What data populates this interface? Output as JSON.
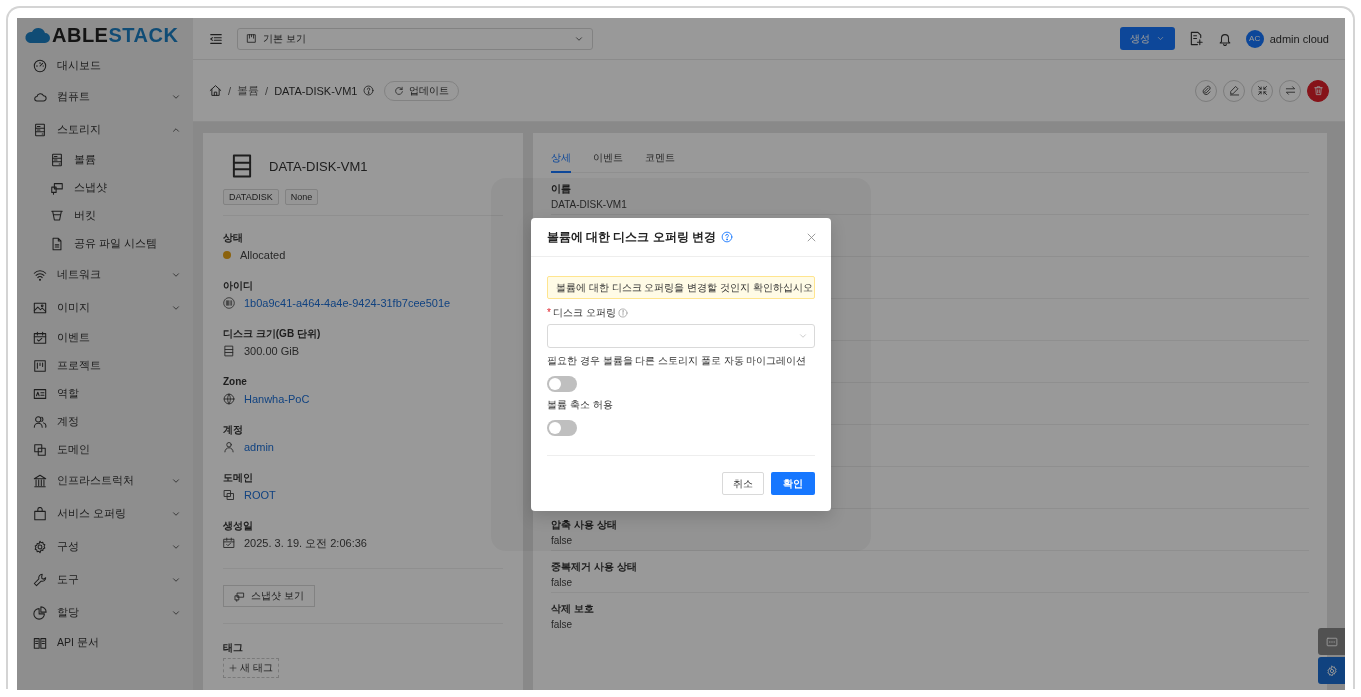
{
  "logo": {
    "first": "ABLE",
    "second": "STACK"
  },
  "sidebar": {
    "items": [
      {
        "label": "대시보드",
        "kind": "link"
      },
      {
        "label": "컴퓨트",
        "kind": "group",
        "expanded": false
      },
      {
        "label": "스토리지",
        "kind": "group",
        "expanded": true,
        "children": [
          {
            "label": "볼륨"
          },
          {
            "label": "스냅샷"
          },
          {
            "label": "버킷"
          },
          {
            "label": "공유 파일 시스템"
          }
        ]
      },
      {
        "label": "네트워크",
        "kind": "group",
        "expanded": false
      },
      {
        "label": "이미지",
        "kind": "group",
        "expanded": false
      },
      {
        "label": "이벤트",
        "kind": "link"
      },
      {
        "label": "프로젝트",
        "kind": "link"
      },
      {
        "label": "역할",
        "kind": "link"
      },
      {
        "label": "계정",
        "kind": "link"
      },
      {
        "label": "도메인",
        "kind": "link"
      },
      {
        "label": "인프라스트럭처",
        "kind": "group",
        "expanded": false
      },
      {
        "label": "서비스 오퍼링",
        "kind": "group",
        "expanded": false
      },
      {
        "label": "구성",
        "kind": "group",
        "expanded": false
      },
      {
        "label": "도구",
        "kind": "group",
        "expanded": false
      },
      {
        "label": "할당",
        "kind": "group",
        "expanded": false
      },
      {
        "label": "API 문서",
        "kind": "link"
      }
    ]
  },
  "header": {
    "view_select": "기본 보기",
    "create_button": "생성",
    "user": {
      "initials": "AC",
      "name": "admin cloud"
    }
  },
  "breadcrumb": {
    "separator": "/",
    "items": [
      "볼륨",
      "DATA-DISK-VM1"
    ],
    "refresh_button": "업데이트"
  },
  "left_card": {
    "title": "DATA-DISK-VM1",
    "tags": [
      "DATADISK",
      "None"
    ],
    "fields": [
      {
        "label": "상태",
        "value": "Allocated",
        "kind": "status"
      },
      {
        "label": "아이디",
        "value": "1b0a9c41-a464-4a4e-9424-31fb7cee501e",
        "kind": "link"
      },
      {
        "label": "디스크 크기(GB 단위)",
        "value": "300.00 GiB",
        "kind": "text"
      },
      {
        "label": "Zone",
        "value": "Hanwha-PoC",
        "kind": "link"
      },
      {
        "label": "계정",
        "value": "admin",
        "kind": "link"
      },
      {
        "label": "도메인",
        "value": "ROOT",
        "kind": "link"
      },
      {
        "label": "생성일",
        "value": "2025. 3. 19. 오전 2:06:36",
        "kind": "text"
      }
    ],
    "snapshot_button": "스냅샷 보기",
    "tags_label": "태그",
    "add_tag_button": "새 태그"
  },
  "right_card": {
    "tabs": [
      {
        "label": "상세",
        "selected": true
      },
      {
        "label": "이벤트",
        "selected": false
      },
      {
        "label": "코멘트",
        "selected": false
      }
    ],
    "rows_top": [
      {
        "label": "이름",
        "value": "DATA-DISK-VM1"
      }
    ],
    "rows_bottom": [
      {
        "label": "압축 사용 상태",
        "value": "false"
      },
      {
        "label": "중복제거 사용 상태",
        "value": "false"
      },
      {
        "label": "삭제 보호",
        "value": "false"
      }
    ]
  },
  "modal": {
    "title": "볼륨에 대한 디스크 오퍼링 변경",
    "alert": "볼륨에 대한 디스크 오퍼링을 변경할 것인지 확인하십시오",
    "field": {
      "label": "디스크 오퍼링",
      "required_mark": "*"
    },
    "toggles": [
      {
        "label": "필요한 경우 볼륨을 다른 스토리지 풀로 자동 마이그레이션",
        "on": false
      },
      {
        "label": "볼륨 축소 허용",
        "on": false
      }
    ],
    "cancel_button": "취소",
    "ok_button": "확인"
  }
}
